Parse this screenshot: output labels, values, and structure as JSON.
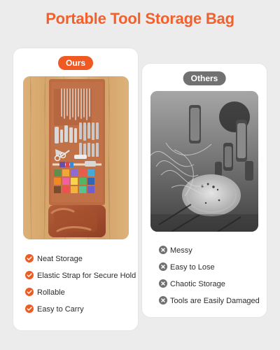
{
  "title": "Portable Tool Storage Bag",
  "left_card": {
    "badge": "Ours",
    "features": [
      "Neat Storage",
      "Elastic Strap for Secure Hold",
      "Rollable",
      "Easy to Carry"
    ],
    "accent": "#ef5a22"
  },
  "right_card": {
    "badge": "Others",
    "drawbacks": [
      "Messy",
      "Easy to Lose",
      "Chaotic Storage",
      "Tools are Easily Damaged"
    ],
    "accent": "#717171"
  },
  "icons": {
    "check": "check-circle-icon",
    "cross": "x-circle-icon"
  }
}
